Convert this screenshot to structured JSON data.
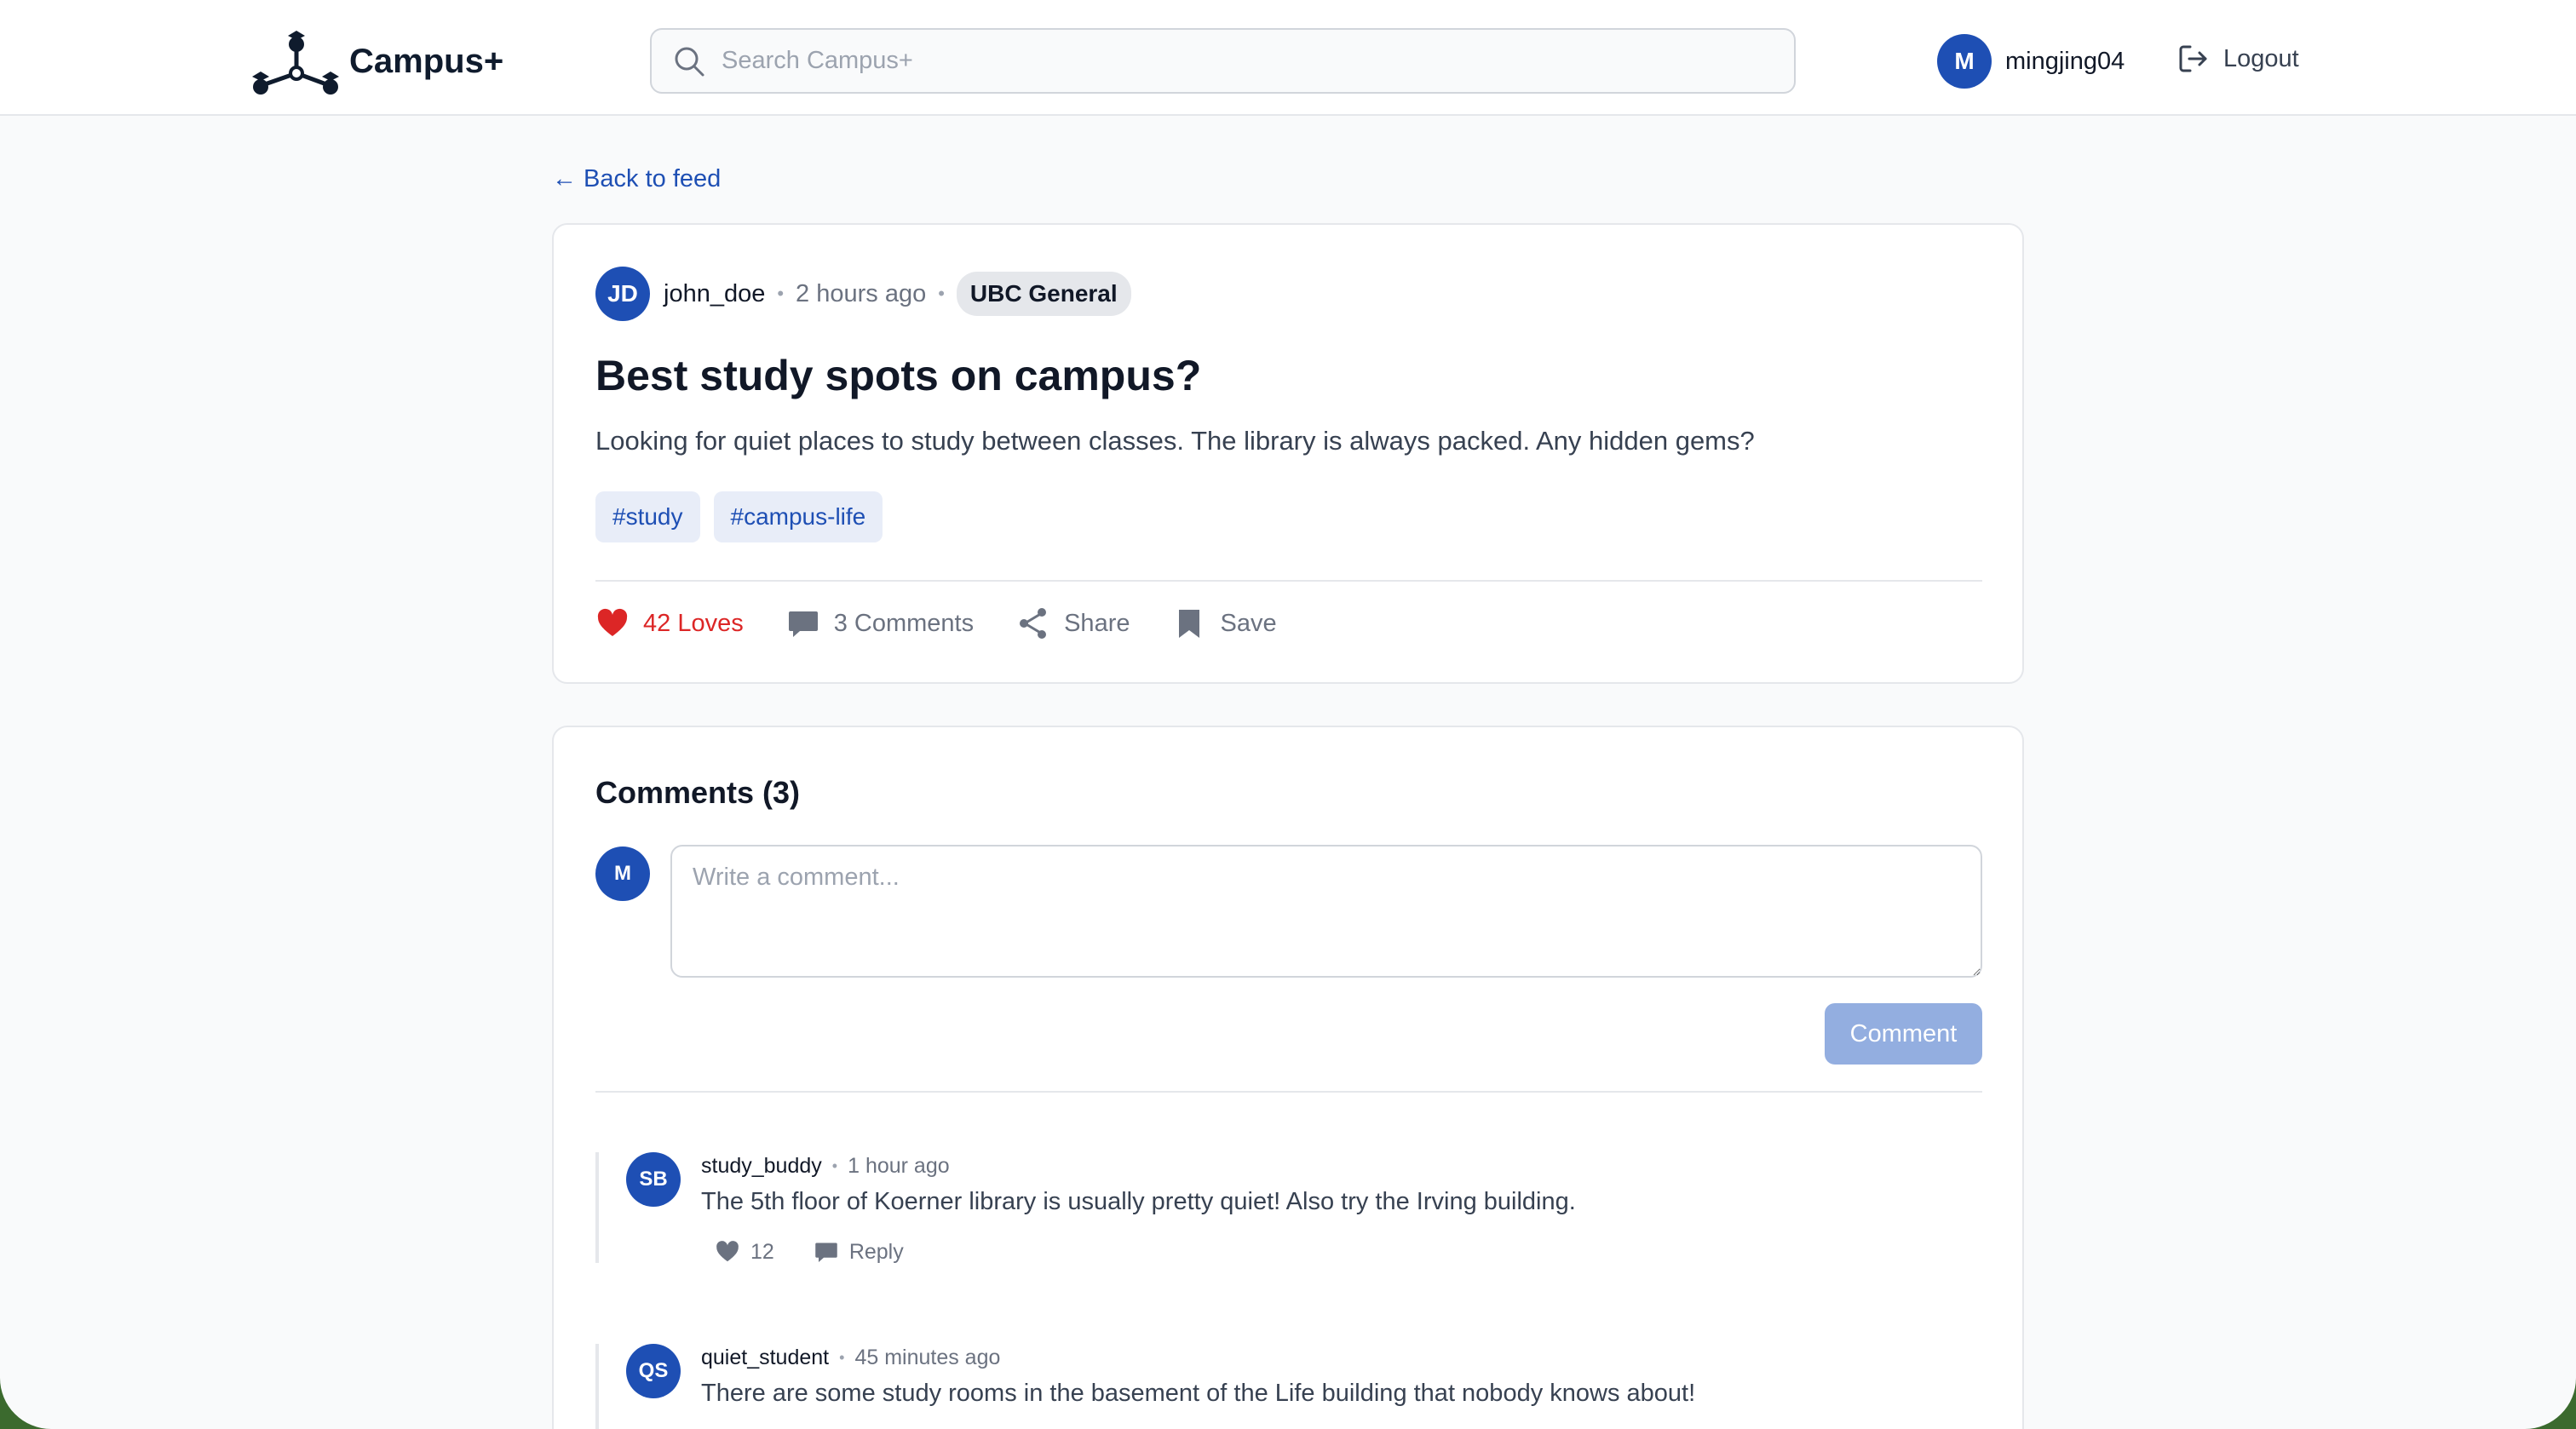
{
  "app": {
    "name": "Campus+"
  },
  "header": {
    "search_placeholder": "Search Campus+",
    "user": {
      "initial": "M",
      "username": "mingjing04"
    },
    "logout_label": "Logout"
  },
  "back_link": "← Back to feed",
  "post": {
    "author_initials": "JD",
    "author": "john_doe",
    "time": "2 hours ago",
    "community": "UBC General",
    "title": "Best study spots on campus?",
    "body": "Looking for quiet places to study between classes. The library is always packed. Any hidden gems?",
    "tags": [
      "#study",
      "#campus-life"
    ],
    "actions": {
      "loves": "42 Loves",
      "comments": "3 Comments",
      "share": "Share",
      "save": "Save"
    }
  },
  "comments_section": {
    "title": "Comments (3)",
    "composer_avatar": "M",
    "composer_placeholder": "Write a comment...",
    "submit_label": "Comment",
    "items": [
      {
        "initials": "SB",
        "author": "study_buddy",
        "time": "1 hour ago",
        "text": "The 5th floor of Koerner library is usually pretty quiet! Also try the Irving building.",
        "likes": "12",
        "reply_label": "Reply"
      },
      {
        "initials": "QS",
        "author": "quiet_student",
        "time": "45 minutes ago",
        "text": "There are some study rooms in the basement of the Life building that nobody knows about!"
      }
    ]
  },
  "colors": {
    "brand": "#1e4fb4",
    "love": "#dc2626",
    "button_disabled": "#93aee0",
    "logo": "#0f1b2d"
  },
  "icons": [
    "campus-logo-icon",
    "search-icon",
    "logout-icon",
    "heart-icon",
    "comment-icon",
    "share-icon",
    "bookmark-icon",
    "reply-icon"
  ]
}
